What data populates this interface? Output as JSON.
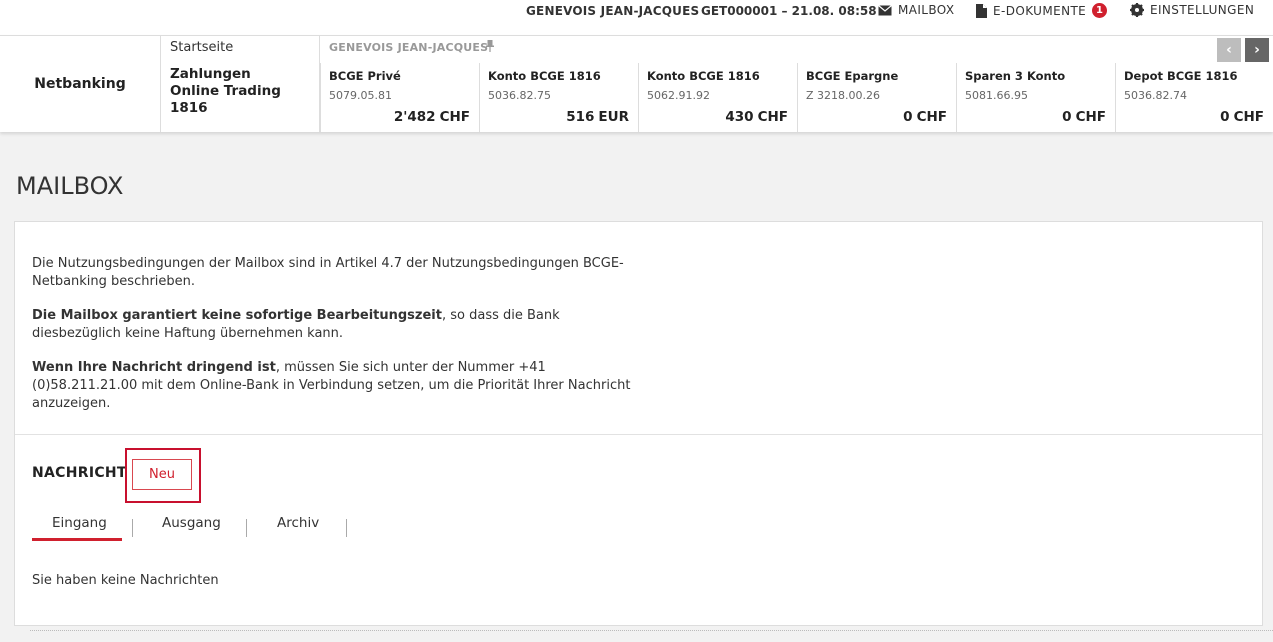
{
  "topbar": {
    "user": "GENEVOIS JEAN-JACQUES",
    "contract": "GET000001 – 21.08. 08:58",
    "mailbox": "MAILBOX",
    "edocs": "E-DOKUMENTE",
    "edocs_badge": "1",
    "settings": "EINSTELLUNGEN"
  },
  "header": {
    "brand": "Netbanking",
    "nav": {
      "startseite": "Startseite",
      "zahlungen": "Zahlungen",
      "online_trading": "Online Trading 1816"
    },
    "holder": "GENEVOIS JEAN-JACQUES",
    "accounts": [
      {
        "name": "BCGE Privé",
        "number": "5079.05.81",
        "amount": "2'482",
        "currency": "CHF"
      },
      {
        "name": "Konto BCGE 1816",
        "number": "5036.82.75",
        "amount": "516",
        "currency": "EUR"
      },
      {
        "name": "Konto BCGE 1816",
        "number": "5062.91.92",
        "amount": "430",
        "currency": "CHF"
      },
      {
        "name": "BCGE Epargne",
        "number": "Z 3218.00.26",
        "amount": "0",
        "currency": "CHF"
      },
      {
        "name": "Sparen 3 Konto",
        "number": "5081.66.95",
        "amount": "0",
        "currency": "CHF"
      },
      {
        "name": "Depot BCGE 1816",
        "number": "5036.82.74",
        "amount": "0",
        "currency": "CHF"
      }
    ]
  },
  "page": {
    "title": "MAILBOX"
  },
  "info": {
    "p1": "Die Nutzungsbedingungen der Mailbox sind in Artikel 4.7 der Nutzungsbedingungen BCGE-Netbanking beschrieben.",
    "p2_bold": "Die Mailbox garantiert keine sofortige Bearbeitungszeit",
    "p2_rest": ", so dass die Bank diesbezüglich keine Haftung übernehmen kann.",
    "p3_bold": "Wenn Ihre Nachricht dringend ist",
    "p3_rest": ", müssen Sie sich unter der Nummer +41 (0)58.211.21.00 mit dem Online-Bank in Verbindung setzen, um die Priorität Ihrer Nachricht anzuzeigen."
  },
  "messages": {
    "label": "NACHRICHT",
    "new_button": "Neu",
    "tabs": [
      "Eingang",
      "Ausgang",
      "Archiv"
    ],
    "empty": "Sie haben keine Nachrichten"
  },
  "colors": {
    "accent": "#d0202e",
    "background": "#f2f2f2"
  }
}
